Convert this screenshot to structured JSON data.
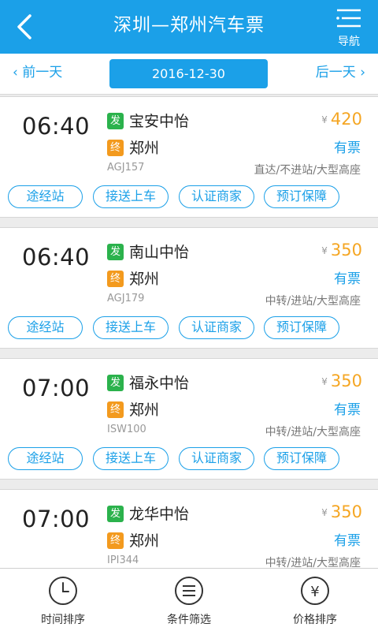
{
  "header": {
    "title": "深圳—郑州汽车票",
    "nav_label": "导航"
  },
  "datebar": {
    "prev": "‹ 前一天",
    "date": "2016-12-30",
    "next": "后一天 ›"
  },
  "tag_labels": [
    "途经站",
    "接送上车",
    "认证商家",
    "预订保障"
  ],
  "badges": {
    "dep": "发",
    "arr": "终"
  },
  "trips": [
    {
      "time": "06:40",
      "from": "宝安中怡",
      "to": "郑州",
      "code": "AGJ157",
      "currency": "¥",
      "price": "420",
      "availability": "有票",
      "info": "直达/不进站/大型高座"
    },
    {
      "time": "06:40",
      "from": "南山中怡",
      "to": "郑州",
      "code": "AGJ179",
      "currency": "¥",
      "price": "350",
      "availability": "有票",
      "info": "中转/进站/大型高座"
    },
    {
      "time": "07:00",
      "from": "福永中怡",
      "to": "郑州",
      "code": "ISW100",
      "currency": "¥",
      "price": "350",
      "availability": "有票",
      "info": "中转/进站/大型高座"
    },
    {
      "time": "07:00",
      "from": "龙华中怡",
      "to": "郑州",
      "code": "IPI344",
      "currency": "¥",
      "price": "350",
      "availability": "有票",
      "info": "中转/进站/大型高座"
    }
  ],
  "footer": {
    "time_sort": "时间排序",
    "filter": "条件筛选",
    "price_sort": "价格排序",
    "price_icon_glyph": "¥"
  },
  "colors": {
    "accent": "#1ba0e8",
    "price": "#f5a623",
    "dep_badge": "#2bb24c",
    "arr_badge": "#f39a1e"
  }
}
